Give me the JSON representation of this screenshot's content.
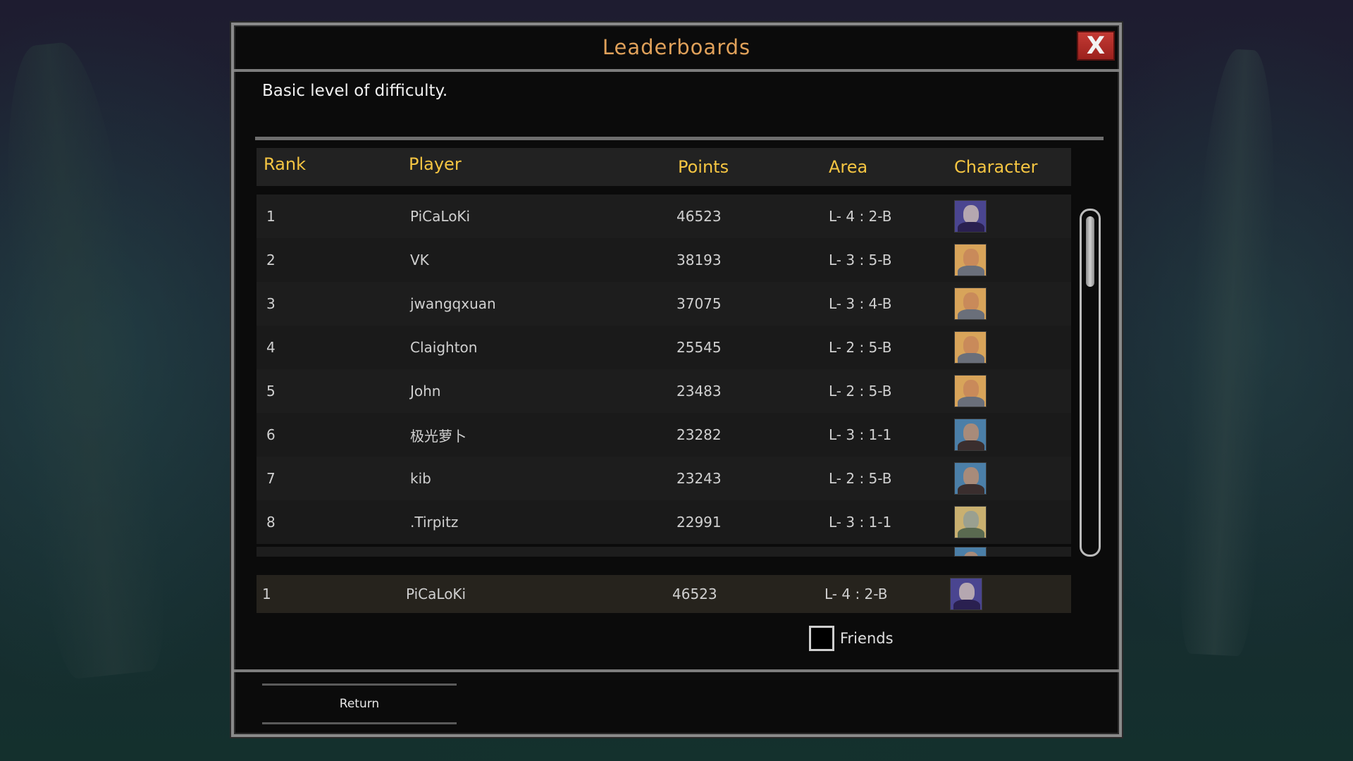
{
  "dialog": {
    "title": "Leaderboards",
    "close_label": "X",
    "description": "Basic level of difficulty."
  },
  "columns": {
    "rank": "Rank",
    "player": "Player",
    "points": "Points",
    "area": "Area",
    "character": "Character"
  },
  "rows": [
    {
      "rank": "1",
      "player": "PiCaLoKi",
      "points": "46523",
      "area": "L- 4 : 2-B",
      "character": "purple-hooded-portrait"
    },
    {
      "rank": "2",
      "player": "VK",
      "points": "38193",
      "area": "L- 3 : 5-B",
      "character": "bald-monk-portrait"
    },
    {
      "rank": "3",
      "player": "jwangqxuan",
      "points": "37075",
      "area": "L- 3 : 4-B",
      "character": "bald-monk-portrait"
    },
    {
      "rank": "4",
      "player": "Claighton",
      "points": "25545",
      "area": "L- 2 : 5-B",
      "character": "bald-monk-portrait"
    },
    {
      "rank": "5",
      "player": "John",
      "points": "23483",
      "area": "L- 2 : 5-B",
      "character": "bald-monk-portrait"
    },
    {
      "rank": "6",
      "player": "极光萝卜",
      "points": "23282",
      "area": "L- 3 : 1-1",
      "character": "bearded-man-portrait"
    },
    {
      "rank": "7",
      "player": "kib",
      "points": "23243",
      "area": "L- 2 : 5-B",
      "character": "bearded-man-portrait"
    },
    {
      "rank": "8",
      "player": ".Tirpitz",
      "points": "22991",
      "area": "L- 3 : 1-1",
      "character": "old-woman-portrait"
    }
  ],
  "own_entry": {
    "rank": "1",
    "player": "PiCaLoKi",
    "points": "46523",
    "area": "L- 4 : 2-B",
    "character": "purple-hooded-portrait"
  },
  "friends_filter": {
    "label": "Friends",
    "checked": false
  },
  "footer": {
    "return_label": "Return"
  },
  "colors": {
    "title": "#e0a15a",
    "column_header": "#f5c542",
    "close_button": "#b52e29",
    "panel": "#0b0b0b"
  }
}
